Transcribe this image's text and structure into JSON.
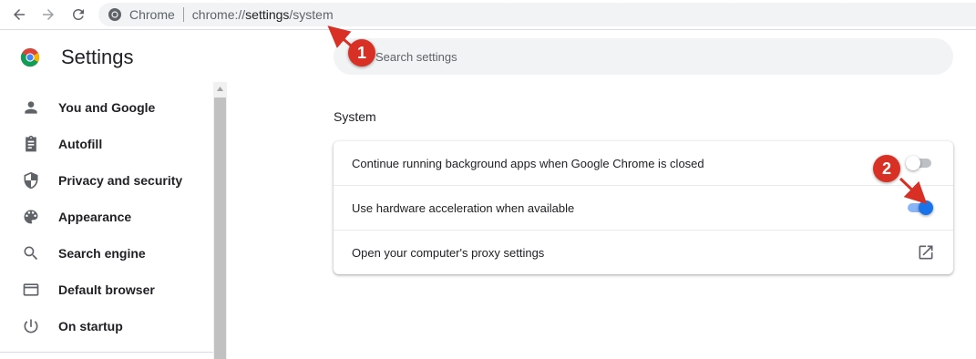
{
  "toolbar": {
    "back_icon": "arrow-left-icon",
    "forward_icon": "arrow-right-icon",
    "reload_icon": "reload-icon"
  },
  "omnibox": {
    "site_label": "Chrome",
    "url_prefix": "chrome://",
    "url_strong": "settings",
    "url_suffix": "/system"
  },
  "header": {
    "title": "Settings"
  },
  "sidebar": {
    "items": [
      {
        "label": "You and Google",
        "icon": "person-icon"
      },
      {
        "label": "Autofill",
        "icon": "clipboard-icon"
      },
      {
        "label": "Privacy and security",
        "icon": "shield-icon"
      },
      {
        "label": "Appearance",
        "icon": "palette-icon"
      },
      {
        "label": "Search engine",
        "icon": "search-icon"
      },
      {
        "label": "Default browser",
        "icon": "browser-window-icon"
      },
      {
        "label": "On startup",
        "icon": "power-icon"
      }
    ]
  },
  "search": {
    "placeholder": "Search settings"
  },
  "section": {
    "title": "System",
    "rows": [
      {
        "label": "Continue running background apps when Google Chrome is closed",
        "toggle": "off"
      },
      {
        "label": "Use hardware acceleration when available",
        "toggle": "on"
      },
      {
        "label": "Open your computer's proxy settings",
        "icon": "open-in-new-icon"
      }
    ]
  },
  "annotations": [
    {
      "number": "1"
    },
    {
      "number": "2"
    }
  ],
  "colors": {
    "accent": "#1a73e8",
    "annotation": "#d93025"
  }
}
